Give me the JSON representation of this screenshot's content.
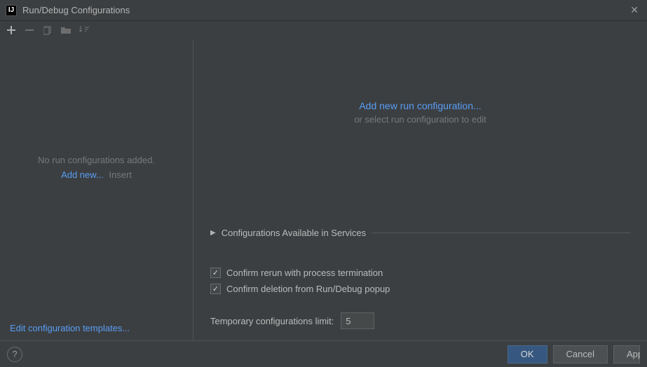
{
  "window": {
    "title": "Run/Debug Configurations"
  },
  "left": {
    "empty_msg": "No run configurations added.",
    "add_new_link": "Add new...",
    "add_new_hint": "Insert",
    "edit_templates": "Edit configuration templates..."
  },
  "right": {
    "add_link": "Add new run configuration...",
    "hint": "or select run configuration to edit",
    "section_title": "Configurations Available in Services",
    "confirm_rerun": "Confirm rerun with process termination",
    "confirm_delete": "Confirm deletion from Run/Debug popup",
    "limit_label": "Temporary configurations limit:",
    "limit_value": "5"
  },
  "footer": {
    "ok": "OK",
    "cancel": "Cancel",
    "apply": "Apply"
  }
}
